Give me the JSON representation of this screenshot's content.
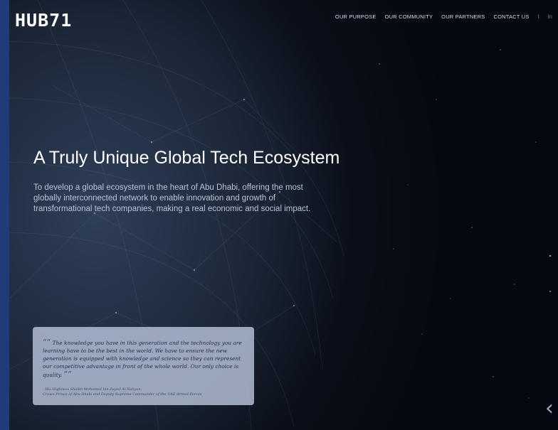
{
  "brand": {
    "logo_text": "HUB71"
  },
  "nav": {
    "items": [
      {
        "label": "OUR PURPOSE"
      },
      {
        "label": "OUR COMMUNITY"
      },
      {
        "label": "OUR PARTNERS"
      },
      {
        "label": "CONTACT US"
      }
    ],
    "social": [
      {
        "icon": "twitter-icon",
        "glyph": "t"
      },
      {
        "icon": "linkedin-icon",
        "glyph": "in"
      }
    ]
  },
  "hero": {
    "headline": "A Truly Unique Global Tech Ecosystem",
    "subtext": "To develop a global ecosystem in the heart of Abu Dhabi, offering the most globally interconnected network to enable innovation and growth of transformational tech companies, making a real economic and social impact."
  },
  "quote": {
    "open_mark": "““",
    "text": "The knowledge you have in this generation and the technology you are learning have to be the best in the world. We have to ensure the new generation is equipped with knowledge and science so they can represent our competitive advantage in front of the whole world. Our only choice is quality.",
    "close_mark": "””",
    "attribution_line1": "- His Highness Sheikh Mohamed bin Zayed Al Nahyan,",
    "attribution_line2": "Crown Prince of Abu Dhabi and Deputy Supreme Commander of the UAE Armed Forces"
  },
  "carousel": {
    "prev_glyph": "‹"
  },
  "colors": {
    "background": "#0b1120",
    "left_bar": "#1f3b7a",
    "quote_card": "#b2bdd2",
    "nav_text": "#d7dde8"
  }
}
